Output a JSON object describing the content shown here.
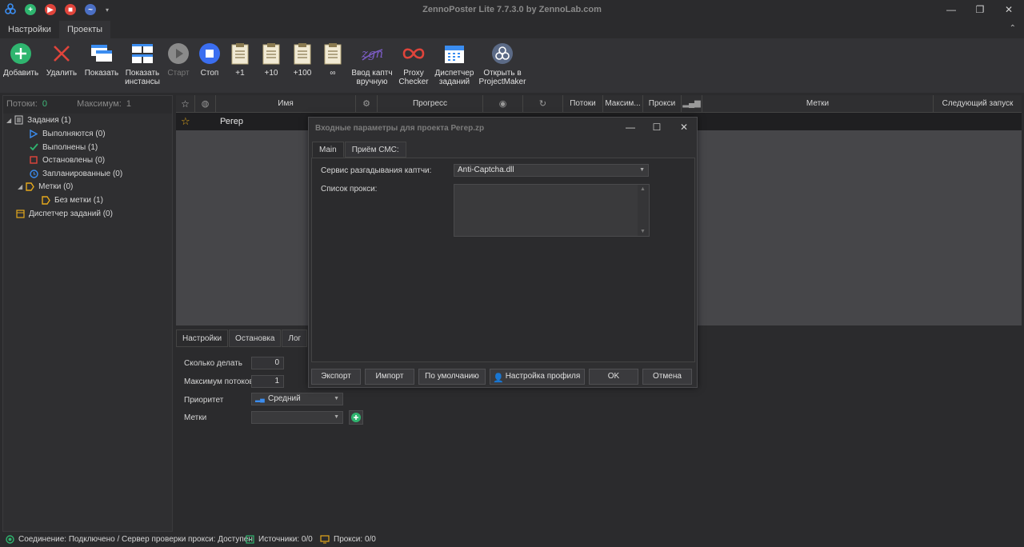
{
  "window": {
    "title": "ZennoPoster Lite 7.7.3.0 by ZennoLab.com"
  },
  "menu": {
    "tabs": [
      "Настройки",
      "Проекты"
    ]
  },
  "toolbar": {
    "add": "Добавить",
    "delete": "Удалить",
    "show": "Показать",
    "show_instances_1": "Показать",
    "show_instances_2": "инстансы",
    "start": "Старт",
    "stop": "Стоп",
    "plus1": "+1",
    "plus10": "+10",
    "plus100": "+100",
    "infinity": "∞",
    "captcha_1": "Ввод каптч",
    "captcha_2": "вручную",
    "proxy_1": "Proxy",
    "proxy_2": "Checker",
    "scheduler_1": "Диспетчер",
    "scheduler_2": "заданий",
    "pm_1": "Открыть в",
    "pm_2": "ProjectMaker"
  },
  "left": {
    "threads_label": "Потоки:",
    "threads_value": "0",
    "max_label": "Максимум:",
    "max_value": "1",
    "tree": {
      "tasks": "Задания (1)",
      "running": "Выполняются (0)",
      "done": "Выполнены (1)",
      "stopped": "Остановлены (0)",
      "scheduled": "Запланированные (0)",
      "tags": "Метки (0)",
      "no_tag": "Без метки (1)",
      "dispatcher": "Диспетчер заданий (0)"
    }
  },
  "table": {
    "columns": {
      "name": "Имя",
      "progress": "Прогресс",
      "threads": "Потоки",
      "max": "Максим...",
      "proxy": "Прокси",
      "tags": "Метки",
      "next_run": "Следующий запуск"
    },
    "row": {
      "name": "Регер"
    }
  },
  "bottom": {
    "tabs": [
      "Настройки",
      "Остановка",
      "Лог"
    ],
    "count_label": "Сколько делать",
    "count_value": "0",
    "max_threads_label": "Максимум потоков",
    "max_threads_value": "1",
    "priority_label": "Приоритет",
    "priority_value": "Средний",
    "tags_label": "Метки"
  },
  "dialog": {
    "title": "Входные параметры для проекта Регер.zp",
    "tabs": [
      "Main",
      "Приём СМС:"
    ],
    "captcha_label": "Сервис разгадывания каптчи:",
    "captcha_value": "Anti-Captcha.dll",
    "proxy_list_label": "Список прокси:",
    "buttons": {
      "export": "Экспорт",
      "import": "Импорт",
      "default": "По умолчанию",
      "profile": "Настройка профиля",
      "ok": "OK",
      "cancel": "Отмена"
    }
  },
  "status": {
    "connection": "Соединение: Подключено / Сервер проверки прокси: Доступен",
    "sources": "Источники: 0/0",
    "proxies": "Прокси: 0/0"
  },
  "colors": {
    "accent_green": "#2fb56f",
    "accent_blue": "#3b6ef0",
    "accent_red": "#e0443b",
    "star": "#e5a91c"
  }
}
